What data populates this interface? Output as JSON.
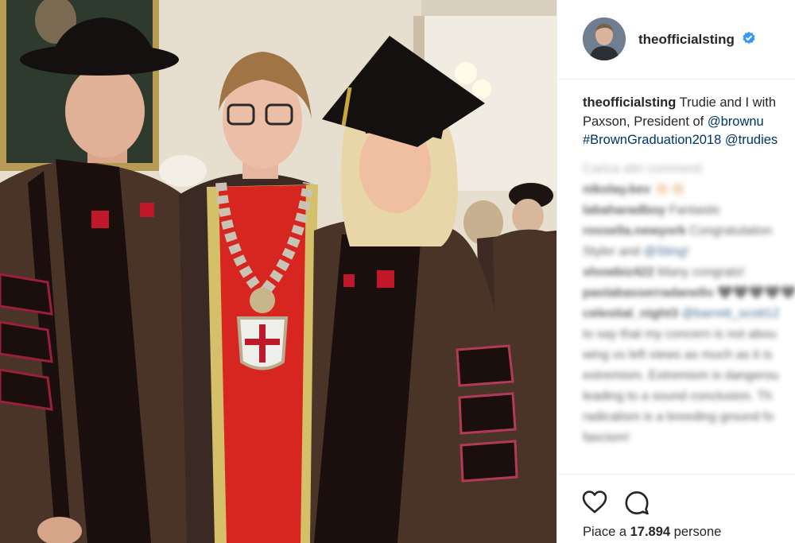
{
  "post": {
    "username": "theofficialsting",
    "verified": true,
    "caption": {
      "user": "theofficialsting",
      "line1_text": " Trudie and I with",
      "line2_text": "Paxson, President of ",
      "line2_tag": "@brownu",
      "line3_tag1": "#BrownGraduation2018",
      "line3_sep": " ",
      "line3_tag2": "@trudies"
    },
    "comments": [
      {
        "text": "Carica altri commenti",
        "muted": true
      },
      {
        "user": "nikolay.kev",
        "text": " 👏🏻👏🏻"
      },
      {
        "user": "labaharadboy",
        "text": " Fantastic"
      },
      {
        "user": "rossella.newyork",
        "text": " Congratulation",
        "user_line": true
      },
      {
        "text": "Styler and ",
        "link": "@Sting!"
      },
      {
        "user": "showbiz422",
        "text": " Many congrats!"
      },
      {
        "user": "paolabasserradanello",
        "text": " 🖤🖤🖤🖤🖤"
      },
      {
        "user": "celestial_night3",
        "text": " ",
        "link": "@barrett_scott12"
      },
      {
        "text": "to say that my concern is not abou"
      },
      {
        "text": "wing vs left views as much as it is"
      },
      {
        "text": "extremism. Extremism is dangerou"
      },
      {
        "text": "leading to a sound conclusion. Th"
      },
      {
        "text": "radicalism is a breeding ground fo"
      },
      {
        "text": "fascism!"
      }
    ],
    "likes_label": "Piace a ",
    "likes_count": "17.894",
    "likes_suffix": " persone"
  },
  "icons": {
    "like": "heart-icon",
    "comment": "speech-bubble-icon",
    "verified": "verified-badge-icon"
  },
  "colors": {
    "link": "#003569",
    "verified": "#3897f0",
    "robe_brown": "#4a3428",
    "robe_velvet": "#1a0f0c",
    "presidential_red": "#d7251f",
    "gold_trim": "#d4c06b"
  }
}
